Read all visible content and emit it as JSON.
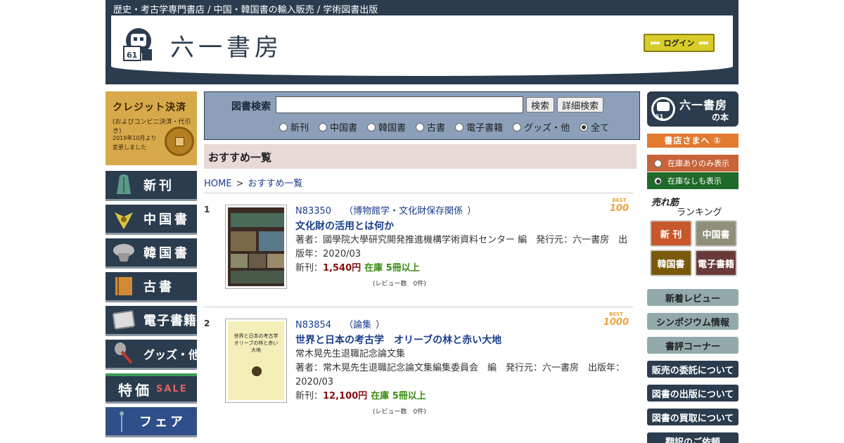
{
  "header": {
    "tagline": "歴史・考古学専門書店 / 中国・韓国書の輸入販売 / 学術図書出版",
    "logo_text": "六一書房",
    "login_label": "ログイン"
  },
  "left_sidebar": {
    "credit_banner": {
      "title": "クレジット決済",
      "subtitle": "(およびコンビニ決済・代引き)",
      "note_line1": "2019年10月より",
      "note_line2": "変更しました"
    },
    "nav": [
      {
        "label": "新刊",
        "icon": "bell-bronze-icon"
      },
      {
        "label": "中国書",
        "icon": "dragon-icon"
      },
      {
        "label": "韓国書",
        "icon": "crown-icon"
      },
      {
        "label": "古書",
        "icon": "old-book-icon"
      },
      {
        "label": "電子書籍",
        "icon": "tablet-icon"
      },
      {
        "label": "グッズ・他",
        "icon": "shovel-icon"
      },
      {
        "label": "特価",
        "sale": "SALE",
        "icon": "sale-icon"
      },
      {
        "label": "フェア",
        "icon": "flag-icon"
      }
    ]
  },
  "search": {
    "label": "図書検索",
    "input_value": "",
    "search_button": "検索",
    "detail_button": "詳細検索",
    "options": [
      "新刊",
      "中国書",
      "韓国書",
      "古書",
      "電子書籍",
      "グッズ・他",
      "全て"
    ],
    "selected": "全て"
  },
  "page_title": "おすすめ一覧",
  "breadcrumb": {
    "home": "HOME",
    "sep": ">",
    "current": "おすすめ一覧"
  },
  "items": [
    {
      "num": "1",
      "code": "N83350",
      "category_open": "（",
      "category": "博物館学・文化財保存関係",
      "category_close": "）",
      "title": "文化財の活用とは何か",
      "subtitle": "",
      "author_line": "著者：國學院大學研究開発推進機構学術資料センター 編　発行元：六一書房　出版年：2020/03",
      "price_label": "新刊：",
      "price": "1,540円",
      "stock": "在庫 5冊以上",
      "review": "(レビュー数　0件)",
      "badge_top": "BEST",
      "badge_num": "100"
    },
    {
      "num": "2",
      "code": "N83854",
      "category_open": "（",
      "category": "論集",
      "category_close": "）",
      "title": "世界と日本の考古学　オリーブの林と赤い大地",
      "subtitle": "常木晃先生退職記念論文集",
      "author_line": "著者：常木晃先生退職記念論文集編集委員会　編　発行元：六一書房　出版年：2020/03",
      "price_label": "新刊：",
      "price": "12,100円",
      "stock": "在庫 5冊以上",
      "review": "(レビュー数　0件)",
      "badge_top": "BEST",
      "badge_num": "1000"
    }
  ],
  "right_sidebar": {
    "logo_line1": "六一書房",
    "logo_line2": "の本",
    "to_shop": "書店さまへ ①",
    "stock_on": "在庫ありのみ表示",
    "stock_off": "在庫なしも表示",
    "ranking_prefix": "売れ筋",
    "ranking_label": "ランキング",
    "ranking_buttons": [
      {
        "label": "新 刊",
        "color": "#c8582a"
      },
      {
        "label": "中国書",
        "color": "#8f8f7a"
      },
      {
        "label": "韓国書",
        "color": "#7a5a0a"
      },
      {
        "label": "電子書籍",
        "color": "#6a3a3a"
      }
    ],
    "links_gray": [
      "新着レビュー",
      "シンポジウム情報",
      "書評コーナー"
    ],
    "links_dark": [
      "販売の委託について",
      "図書の出版について",
      "図書の買取について",
      "翻訳のご依頼"
    ]
  },
  "colors": {
    "navy": "#2b3c4e",
    "search_bg": "#8ca0b9",
    "title_bg": "#e8d8d6",
    "link": "#1a3d8c",
    "price": "#8b1010",
    "stock": "#3a8a10"
  }
}
